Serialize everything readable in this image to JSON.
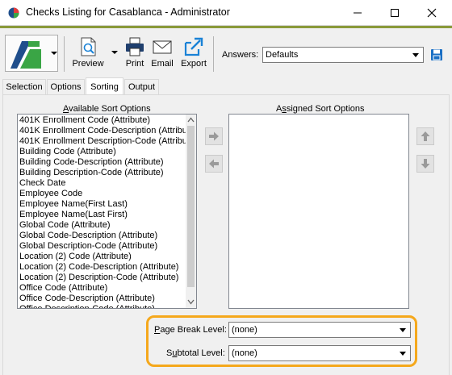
{
  "window": {
    "title": "Checks Listing for Casablanca - Administrator",
    "minimize": "—",
    "maximize": "☐",
    "close": "✕"
  },
  "toolbar": {
    "preview_label": "Preview",
    "print_label": "Print",
    "email_label": "Email",
    "export_label": "Export",
    "answers_label": "Answers:",
    "answers_value": "Defaults"
  },
  "tabs": [
    {
      "label": "Selection"
    },
    {
      "label": "Options"
    },
    {
      "label": "Sorting"
    },
    {
      "label": "Output"
    }
  ],
  "sorting": {
    "available_header_accel": "A",
    "available_header_rest": "vailable Sort Options",
    "assigned_header_pre": "A",
    "assigned_header_accel": "s",
    "assigned_header_rest": "signed Sort Options",
    "available_items": [
      "401K Enrollment Code (Attribute)",
      "401K Enrollment Code-Description (Attribute)",
      "401K Enrollment Description-Code (Attribute)",
      "Building Code (Attribute)",
      "Building Code-Description (Attribute)",
      "Building Description-Code (Attribute)",
      "Check Date",
      "Employee Code",
      "Employee Name(First Last)",
      "Employee Name(Last First)",
      "Global Code (Attribute)",
      "Global Code-Description (Attribute)",
      "Global Description-Code (Attribute)",
      "Location (2) Code (Attribute)",
      "Location (2) Code-Description (Attribute)",
      "Location (2) Description-Code (Attribute)",
      "Office Code (Attribute)",
      "Office Code-Description (Attribute)",
      "Office Description-Code (Attribute)"
    ],
    "assigned_items": [],
    "page_break_label_accel": "P",
    "page_break_label_rest": "age Break Level:",
    "page_break_value": "(none)",
    "subtotal_label_pre": "S",
    "subtotal_label_accel": "u",
    "subtotal_label_rest": "btotal Level:",
    "subtotal_value": "(none)"
  },
  "colors": {
    "accent_bar": "#8a9a3a",
    "highlight": "#f5a81c",
    "logo_green": "#3aa545",
    "logo_blue": "#1f4e8c",
    "export_blue": "#1a82d6",
    "save_blue": "#1a6fc4"
  }
}
